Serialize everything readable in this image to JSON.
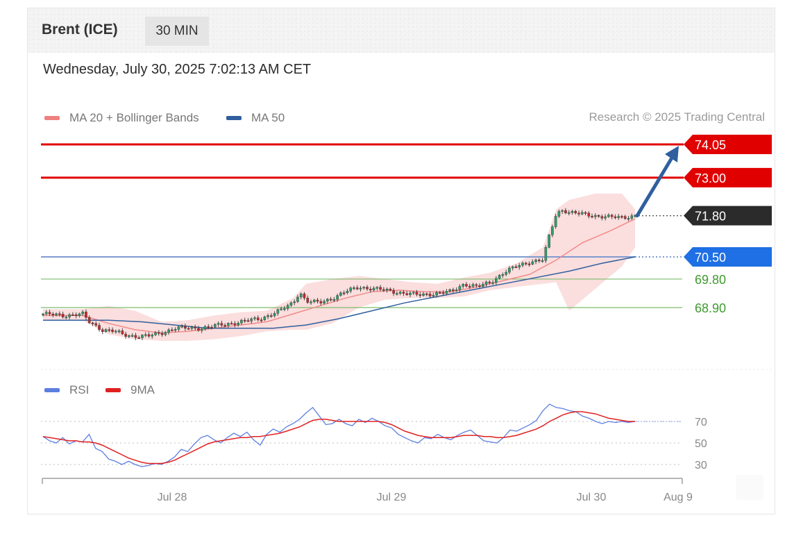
{
  "header": {
    "title": "Brent (ICE)",
    "timeframe": "30 MIN"
  },
  "timestamp": "Wednesday, July 30, 2025 7:02:13 AM CET",
  "legend_top": [
    {
      "label": "MA 20 + Bollinger Bands",
      "color": "#f08080"
    },
    {
      "label": "MA 50",
      "color": "#2f5f9e"
    }
  ],
  "credit": "Research © 2025 Trading Central",
  "legend_bottom": [
    {
      "label": "RSI",
      "color": "#5b7fe0"
    },
    {
      "label": "9MA",
      "color": "#e02020"
    }
  ],
  "colors": {
    "resistance": "#e00000",
    "pivot": "#2f5f9e",
    "support_line": "#7dbb6e",
    "support_text": "#3e9b2e",
    "current": "#333333",
    "current_bg": "#2b2b2b",
    "pivot_bg": "#1f6fe5",
    "up_candle": "#2e9e6b",
    "down_candle": "#c62828",
    "band_fill": "#f9d3d3",
    "ma20": "#f08a8a",
    "ma50": "#2f5f9e",
    "forecast_arrow": "#2f5f9e"
  },
  "chart_data": [
    {
      "type": "candlestick",
      "title": "Brent (ICE)",
      "timeframe": "30 MIN",
      "x_ticks": [
        "Jul 28",
        "Jul 29",
        "Jul 30",
        "Aug 9"
      ],
      "y_range": [
        67.8,
        74.3
      ],
      "series": [
        {
          "name": "MA 20 + Bollinger Bands"
        },
        {
          "name": "MA 50"
        }
      ],
      "levels": [
        {
          "value": 74.05,
          "label": "74.05",
          "kind": "resistance"
        },
        {
          "value": 73.0,
          "label": "73.00",
          "kind": "resistance"
        },
        {
          "value": 71.8,
          "label": "71.80",
          "kind": "current"
        },
        {
          "value": 70.5,
          "label": "70.50",
          "kind": "pivot"
        },
        {
          "value": 69.8,
          "label": "69.80",
          "kind": "support"
        },
        {
          "value": 68.9,
          "label": "68.90",
          "kind": "support"
        }
      ],
      "forecast": {
        "from": 71.8,
        "to": 74.05,
        "direction": "up"
      },
      "price_path": [
        [
          0,
          68.7
        ],
        [
          3,
          68.65
        ],
        [
          6,
          68.7
        ],
        [
          7,
          68.45
        ],
        [
          9,
          68.2
        ],
        [
          11,
          68.15
        ],
        [
          12,
          68.05
        ],
        [
          14,
          68.0
        ],
        [
          16,
          68.0
        ],
        [
          18,
          68.1
        ],
        [
          20,
          68.25
        ],
        [
          22,
          68.25
        ],
        [
          24,
          68.25
        ],
        [
          27,
          68.35
        ],
        [
          30,
          68.45
        ],
        [
          33,
          68.55
        ],
        [
          36,
          68.8
        ],
        [
          38,
          69.05
        ],
        [
          39,
          69.4
        ],
        [
          40,
          69.1
        ],
        [
          42,
          69.05
        ],
        [
          44,
          69.2
        ],
        [
          46,
          69.4
        ],
        [
          48,
          69.55
        ],
        [
          50,
          69.5
        ],
        [
          52,
          69.45
        ],
        [
          55,
          69.35
        ],
        [
          57,
          69.3
        ],
        [
          60,
          69.35
        ],
        [
          62,
          69.4
        ],
        [
          64,
          69.65
        ],
        [
          66,
          69.55
        ],
        [
          68,
          69.7
        ],
        [
          70,
          70.0
        ],
        [
          72,
          70.2
        ],
        [
          74,
          70.35
        ],
        [
          76,
          70.4
        ],
        [
          77,
          71.2
        ],
        [
          78,
          71.85
        ],
        [
          79,
          72.0
        ],
        [
          80,
          71.9
        ],
        [
          82,
          71.85
        ],
        [
          84,
          71.8
        ],
        [
          86,
          71.75
        ],
        [
          88,
          71.75
        ],
        [
          90,
          71.8
        ]
      ],
      "ma20": [
        [
          0,
          68.65
        ],
        [
          6,
          68.65
        ],
        [
          10,
          68.4
        ],
        [
          14,
          68.2
        ],
        [
          18,
          68.1
        ],
        [
          22,
          68.15
        ],
        [
          26,
          68.25
        ],
        [
          30,
          68.35
        ],
        [
          34,
          68.45
        ],
        [
          38,
          68.7
        ],
        [
          42,
          68.95
        ],
        [
          46,
          69.2
        ],
        [
          50,
          69.4
        ],
        [
          54,
          69.45
        ],
        [
          58,
          69.4
        ],
        [
          62,
          69.4
        ],
        [
          66,
          69.55
        ],
        [
          70,
          69.75
        ],
        [
          74,
          69.95
        ],
        [
          78,
          70.4
        ],
        [
          82,
          70.95
        ],
        [
          86,
          71.3
        ],
        [
          90,
          71.7
        ]
      ],
      "ma50": [
        [
          0,
          68.5
        ],
        [
          10,
          68.5
        ],
        [
          15,
          68.45
        ],
        [
          20,
          68.35
        ],
        [
          25,
          68.25
        ],
        [
          30,
          68.25
        ],
        [
          35,
          68.25
        ],
        [
          40,
          68.35
        ],
        [
          45,
          68.55
        ],
        [
          50,
          68.8
        ],
        [
          55,
          69.05
        ],
        [
          60,
          69.25
        ],
        [
          65,
          69.45
        ],
        [
          70,
          69.65
        ],
        [
          75,
          69.85
        ],
        [
          80,
          70.05
        ],
        [
          85,
          70.3
        ],
        [
          90,
          70.5
        ]
      ],
      "band_upper": [
        [
          0,
          68.85
        ],
        [
          6,
          68.85
        ],
        [
          10,
          68.95
        ],
        [
          14,
          68.8
        ],
        [
          18,
          68.45
        ],
        [
          22,
          68.5
        ],
        [
          26,
          68.65
        ],
        [
          30,
          68.75
        ],
        [
          34,
          68.8
        ],
        [
          38,
          69.2
        ],
        [
          40,
          69.65
        ],
        [
          44,
          69.8
        ],
        [
          48,
          69.9
        ],
        [
          52,
          69.8
        ],
        [
          56,
          69.7
        ],
        [
          60,
          69.65
        ],
        [
          64,
          69.85
        ],
        [
          68,
          70.0
        ],
        [
          72,
          70.3
        ],
        [
          76,
          70.8
        ],
        [
          78,
          72.0
        ],
        [
          80,
          72.3
        ],
        [
          84,
          72.5
        ],
        [
          88,
          72.5
        ],
        [
          90,
          72.0
        ]
      ],
      "band_lower": [
        [
          0,
          68.5
        ],
        [
          6,
          68.5
        ],
        [
          10,
          68.05
        ],
        [
          14,
          67.9
        ],
        [
          18,
          67.85
        ],
        [
          22,
          67.85
        ],
        [
          26,
          67.9
        ],
        [
          30,
          68.0
        ],
        [
          34,
          68.15
        ],
        [
          38,
          68.2
        ],
        [
          40,
          68.2
        ],
        [
          44,
          68.4
        ],
        [
          48,
          68.9
        ],
        [
          52,
          69.15
        ],
        [
          56,
          69.2
        ],
        [
          60,
          69.2
        ],
        [
          64,
          69.25
        ],
        [
          68,
          69.45
        ],
        [
          72,
          69.55
        ],
        [
          76,
          69.65
        ],
        [
          78,
          69.7
        ],
        [
          80,
          68.8
        ],
        [
          84,
          69.5
        ],
        [
          88,
          70.2
        ],
        [
          90,
          70.8
        ]
      ]
    },
    {
      "type": "line",
      "title": "RSI",
      "y_ticks": [
        70,
        50,
        30
      ],
      "y_range": [
        20,
        90
      ],
      "series": [
        {
          "name": "RSI",
          "values": [
            56,
            52,
            50,
            55,
            49,
            52,
            51,
            58,
            45,
            42,
            35,
            33,
            30,
            33,
            30,
            28,
            29,
            31,
            30,
            33,
            37,
            44,
            42,
            49,
            55,
            57,
            53,
            50,
            55,
            59,
            56,
            60,
            53,
            48,
            58,
            63,
            60,
            65,
            68,
            72,
            78,
            83,
            75,
            67,
            68,
            72,
            68,
            66,
            72,
            69,
            73,
            70,
            66,
            64,
            58,
            55,
            52,
            50,
            55,
            54,
            58,
            55,
            53,
            57,
            60,
            62,
            57,
            52,
            51,
            50,
            55,
            62,
            61,
            64,
            67,
            71,
            80,
            86,
            83,
            82,
            80,
            79,
            75,
            73,
            70,
            68,
            70,
            69,
            70,
            69,
            70
          ]
        },
        {
          "name": "9MA",
          "values": [
            56,
            55,
            54,
            53,
            52,
            52,
            51,
            51,
            50,
            48,
            45,
            42,
            39,
            36,
            34,
            32,
            31,
            31,
            31,
            32,
            34,
            37,
            40,
            43,
            46,
            49,
            51,
            52,
            53,
            54,
            55,
            55,
            56,
            56,
            57,
            58,
            59,
            61,
            63,
            65,
            68,
            71,
            72,
            72,
            71,
            70,
            70,
            70,
            70,
            70,
            70,
            70,
            69,
            67,
            64,
            61,
            59,
            57,
            56,
            55,
            55,
            55,
            55,
            56,
            57,
            57,
            57,
            56,
            56,
            55,
            55,
            56,
            57,
            59,
            61,
            63,
            66,
            70,
            73,
            76,
            78,
            79,
            79,
            78,
            77,
            75,
            73,
            72,
            71,
            70,
            70
          ]
        }
      ]
    }
  ]
}
